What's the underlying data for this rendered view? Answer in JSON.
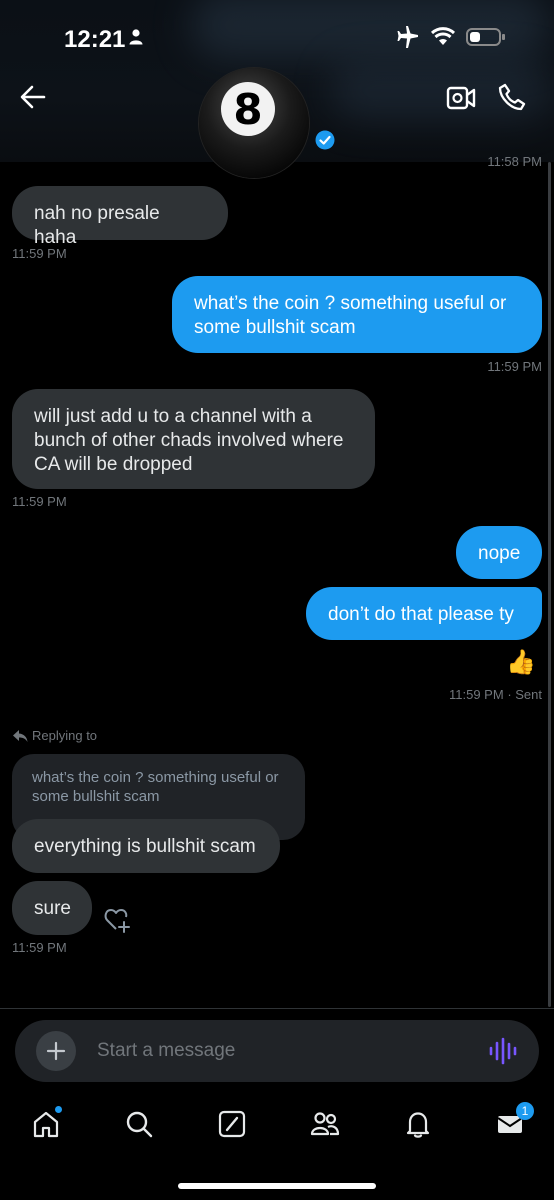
{
  "status_bar": {
    "time": "12:21"
  },
  "messages": {
    "top_timestamp": "11:58 PM",
    "m1": {
      "text": "nah no presale haha",
      "time": "11:59 PM"
    },
    "m2": {
      "text": "what’s the coin ?  something useful or some bullshit scam",
      "time": "11:59 PM"
    },
    "m3": {
      "text": "will just add u to a channel with a bunch of other chads involved where CA will be dropped",
      "time": "11:59 PM"
    },
    "m4": {
      "text": "nope"
    },
    "m5": {
      "text": "don’t do that please ty",
      "reaction": "👍",
      "time": "11:59 PM",
      "status": "· Sent"
    },
    "reply": {
      "label": "Replying to",
      "quoted": "what’s the coin ?  something useful or some bullshit scam",
      "text": "everything is bullshit scam"
    },
    "m7": {
      "text": "sure",
      "time": "11:59 PM"
    }
  },
  "composer": {
    "placeholder": "Start a message"
  },
  "nav": {
    "messages_badge": "1"
  },
  "colors": {
    "accent": "#1d9bf0",
    "incoming": "#2f3336",
    "voice": "#7856ff"
  },
  "icons": [
    "back-arrow-icon",
    "video-camera-icon",
    "phone-icon",
    "verified-badge-icon",
    "reply-arrow-icon",
    "heart-add-icon",
    "plus-icon",
    "voice-wave-icon",
    "home-icon",
    "search-icon",
    "grok-icon",
    "communities-icon",
    "bell-icon",
    "mail-icon"
  ]
}
